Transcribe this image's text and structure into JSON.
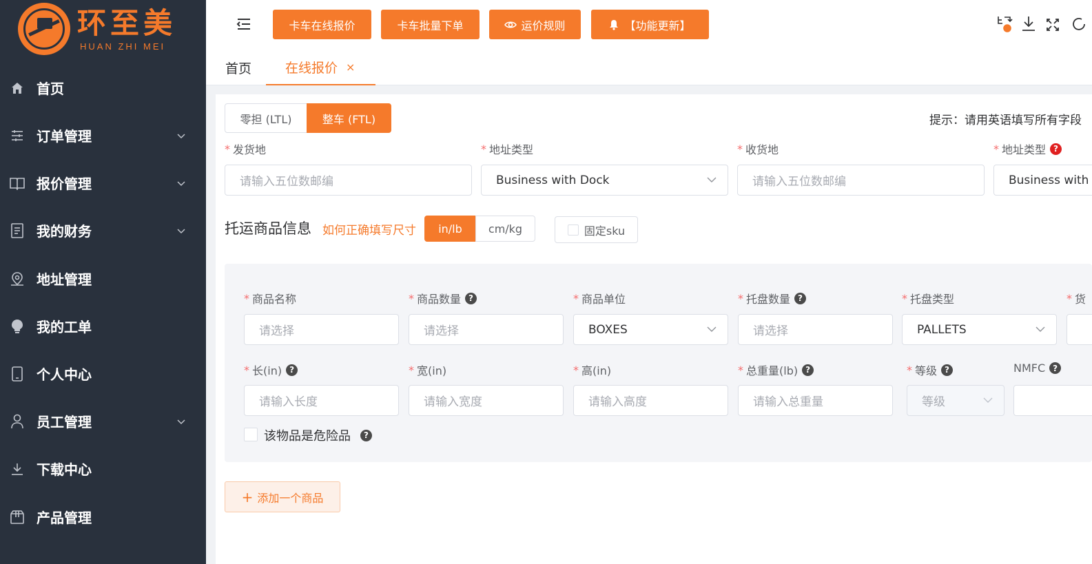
{
  "brand": {
    "name": "环至美",
    "sub": "HUAN ZHI MEI",
    "accent": "#f57a2b",
    "sidebar_bg": "#29313d"
  },
  "sidebar": {
    "items": [
      {
        "label": "首页",
        "icon": "home-icon",
        "has_children": false
      },
      {
        "label": "订单管理",
        "icon": "sliders-icon",
        "has_children": true
      },
      {
        "label": "报价管理",
        "icon": "book-icon",
        "has_children": true
      },
      {
        "label": "我的财务",
        "icon": "document-icon",
        "has_children": true
      },
      {
        "label": "地址管理",
        "icon": "location-icon",
        "has_children": false
      },
      {
        "label": "我的工单",
        "icon": "bulb-icon",
        "has_children": false
      },
      {
        "label": "个人中心",
        "icon": "tablet-icon",
        "has_children": false
      },
      {
        "label": "员工管理",
        "icon": "user-icon",
        "has_children": true
      },
      {
        "label": "下载中心",
        "icon": "download-icon",
        "has_children": false
      },
      {
        "label": "产品管理",
        "icon": "box-icon",
        "has_children": false
      }
    ]
  },
  "topbar": {
    "buttons": [
      {
        "label": "卡车在线报价"
      },
      {
        "label": "卡车批量下单"
      },
      {
        "label": "运价规则",
        "icon": "eye-icon"
      },
      {
        "label": "【功能更新】",
        "icon": "bell-icon"
      }
    ],
    "right_icons": [
      "translate-icon",
      "download-icon",
      "fullscreen-icon",
      "refresh-icon"
    ]
  },
  "tabs": [
    {
      "label": "首页",
      "active": false
    },
    {
      "label": "在线报价",
      "active": true,
      "close": "×"
    }
  ],
  "form": {
    "mode": {
      "ltl": "零担 (LTL)",
      "ftl": "整车 (FTL)",
      "selected": "ftl"
    },
    "hint": "提示：请用英语填写所有字段",
    "origin": {
      "label": "发货地",
      "placeholder": "请输入五位数邮编"
    },
    "origin_type": {
      "label": "地址类型",
      "value": "Business with Dock"
    },
    "dest": {
      "label": "收货地",
      "placeholder": "请输入五位数邮编"
    },
    "dest_type": {
      "label": "地址类型",
      "value": "Business with Dock"
    },
    "goods_title": "托运商品信息",
    "size_link": "如何正确填写尺寸",
    "unit": {
      "imperial": "in/lb",
      "metric": "cm/kg",
      "selected": "imperial"
    },
    "fixed_sku": "固定sku",
    "goods": {
      "name": {
        "label": "商品名称",
        "placeholder": "请选择"
      },
      "qty": {
        "label": "商品数量",
        "placeholder": "请选择"
      },
      "unit": {
        "label": "商品单位",
        "value": "BOXES"
      },
      "pallet_qty": {
        "label": "托盘数量",
        "placeholder": "请选择"
      },
      "pallet_type": {
        "label": "托盘类型",
        "value": "PALLETS"
      },
      "cut_label": "货",
      "length": {
        "label": "长(in)",
        "placeholder": "请输入长度"
      },
      "width": {
        "label": "宽(in)",
        "placeholder": "请输入宽度"
      },
      "height": {
        "label": "高(in)",
        "placeholder": "请输入高度"
      },
      "weight": {
        "label": "总重量(lb)",
        "placeholder": "请输入总重量"
      },
      "grade": {
        "label": "等级",
        "placeholder": "等级"
      },
      "nmfc": {
        "label": "NMFC"
      },
      "hazmat": "该物品是危险品"
    },
    "add_goods": "添加一个商品"
  }
}
